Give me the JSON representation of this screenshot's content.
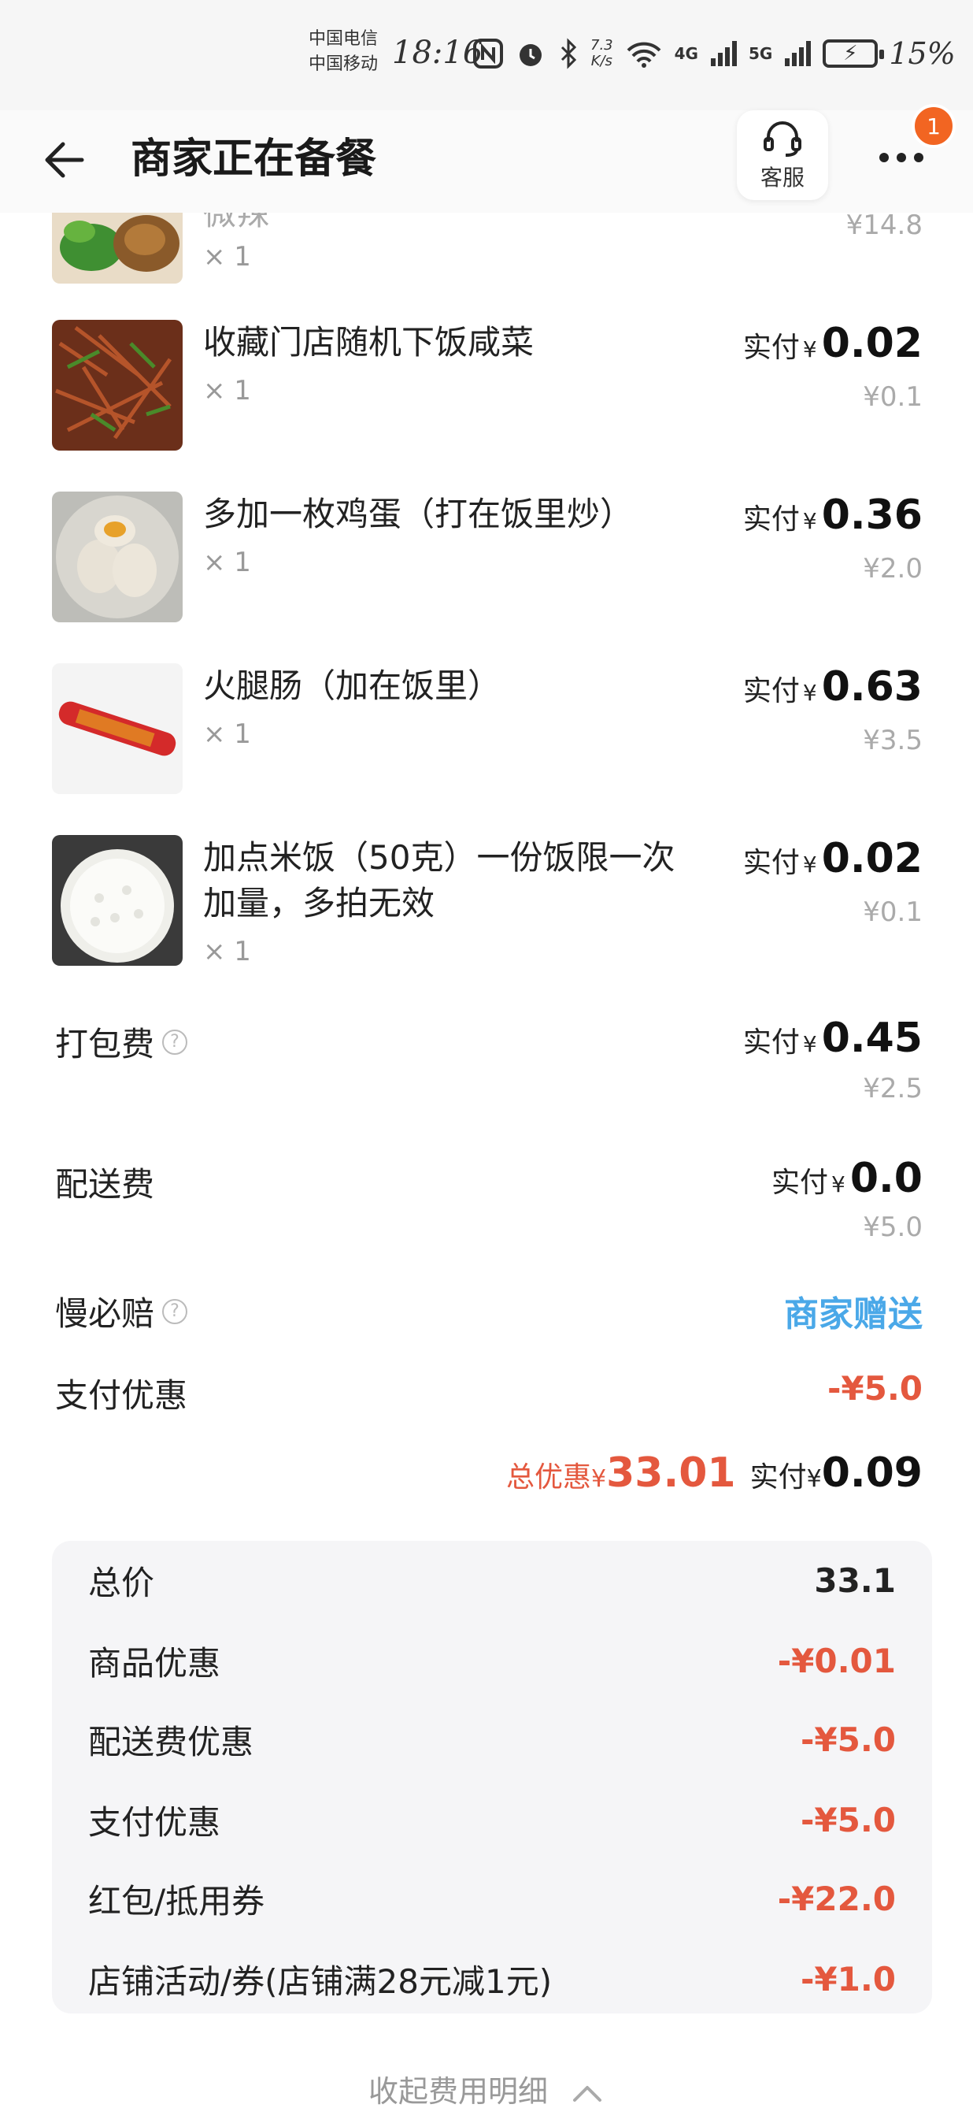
{
  "status_bar": {
    "carrier1": "中国电信",
    "carrier2": "中国移动",
    "time": "18:16",
    "speed_value": "7.3",
    "speed_unit": "K/s",
    "net1": "4G",
    "net2": "5G",
    "battery": "15%"
  },
  "header": {
    "title": "商家正在备餐",
    "service_label": "客服",
    "badge_count": "1"
  },
  "items": [
    {
      "name": "微辣",
      "qty": "× 1",
      "original": "¥14.8"
    },
    {
      "name": "收藏门店随机下饭咸菜",
      "qty": "× 1",
      "paid_label": "实付",
      "currency": "¥",
      "paid_value": "0.02",
      "original": "¥0.1"
    },
    {
      "name": "多加一枚鸡蛋（打在饭里炒）",
      "qty": "× 1",
      "paid_label": "实付",
      "currency": "¥",
      "paid_value": "0.36",
      "original": "¥2.0"
    },
    {
      "name": "火腿肠（加在饭里）",
      "qty": "× 1",
      "paid_label": "实付",
      "currency": "¥",
      "paid_value": "0.63",
      "original": "¥3.5"
    },
    {
      "name": "加点米饭（50克）一份饭限一次加量，多拍无效",
      "qty": "× 1",
      "paid_label": "实付",
      "currency": "¥",
      "paid_value": "0.02",
      "original": "¥0.1"
    }
  ],
  "packing_fee": {
    "label": "打包费",
    "paid_label": "实付",
    "currency": "¥",
    "paid_value": "0.45",
    "original": "¥2.5"
  },
  "delivery_fee": {
    "label": "配送费",
    "paid_label": "实付",
    "currency": "¥",
    "paid_value": "0.0",
    "original": "¥5.0"
  },
  "late_compensation": {
    "label": "慢必赔",
    "value": "商家赠送"
  },
  "payment_discount": {
    "label": "支付优惠",
    "value": "-¥5.0"
  },
  "totals": {
    "discount_label": "总优惠",
    "currency": "¥",
    "discount_value": "33.01",
    "paid_label": "实付",
    "paid_value": "0.09"
  },
  "summary": [
    {
      "label": "总价",
      "value": "33.1",
      "red": false
    },
    {
      "label": "商品优惠",
      "value": "-¥0.01",
      "red": true
    },
    {
      "label": "配送费优惠",
      "value": "-¥5.0",
      "red": true
    },
    {
      "label": "支付优惠",
      "value": "-¥5.0",
      "red": true
    },
    {
      "label": "红包/抵用券",
      "value": "-¥22.0",
      "red": true
    },
    {
      "label": "店铺活动/券(店铺满28元减1元)",
      "value": "-¥1.0",
      "red": true
    }
  ],
  "collapse_label": "收起费用明细",
  "colors": {
    "accent_red": "#e4583e",
    "accent_blue": "#4aa8e8",
    "badge": "#f26522"
  }
}
